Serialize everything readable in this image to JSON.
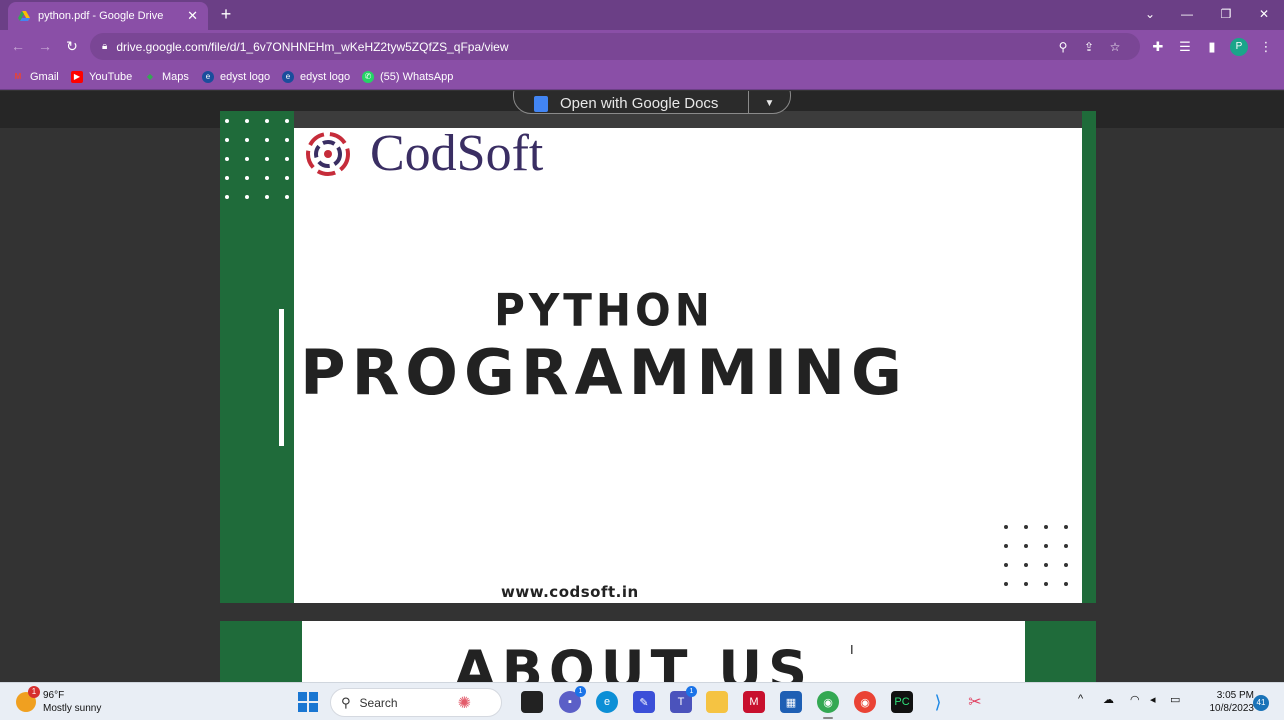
{
  "browser": {
    "tab_title": "python.pdf - Google Drive",
    "url": "drive.google.com/file/d/1_6v7ONHNEHm_wKeHZ2tyw5ZQfZS_qFpa/view",
    "new_tab_symbol": "+",
    "profile_initial": "P",
    "colors": {
      "frame": "#6b3f86",
      "toolbar": "#8a4fa7",
      "omnibox": "#7a4695"
    }
  },
  "bookmarks": [
    {
      "label": "Gmail",
      "icon": "gmail-icon"
    },
    {
      "label": "YouTube",
      "icon": "youtube-icon"
    },
    {
      "label": "Maps",
      "icon": "maps-icon"
    },
    {
      "label": "edyst logo",
      "icon": "edyst-icon"
    },
    {
      "label": "edyst logo",
      "icon": "edyst-icon"
    },
    {
      "label": "(55) WhatsApp",
      "icon": "whatsapp-icon"
    }
  ],
  "viewer": {
    "open_with_label": "Open with Google Docs"
  },
  "slide1": {
    "logo_text": "CodSoft",
    "title_line1": "PYTHON",
    "title_line2": "PROGRAMMING",
    "website": "www.codsoft.in",
    "colors": {
      "green": "#1f6b3a",
      "text": "#222222",
      "logo": "#3a2e63"
    }
  },
  "slide2": {
    "heading": "ABOUT US"
  },
  "taskbar": {
    "weather_temp": "96°F",
    "weather_desc": "Mostly sunny",
    "weather_badge": "1",
    "search_label": "Search",
    "time": "3:05 PM",
    "date": "10/8/2023",
    "notification_count": "41",
    "teams_badge": "1",
    "chat_badge": "1"
  }
}
